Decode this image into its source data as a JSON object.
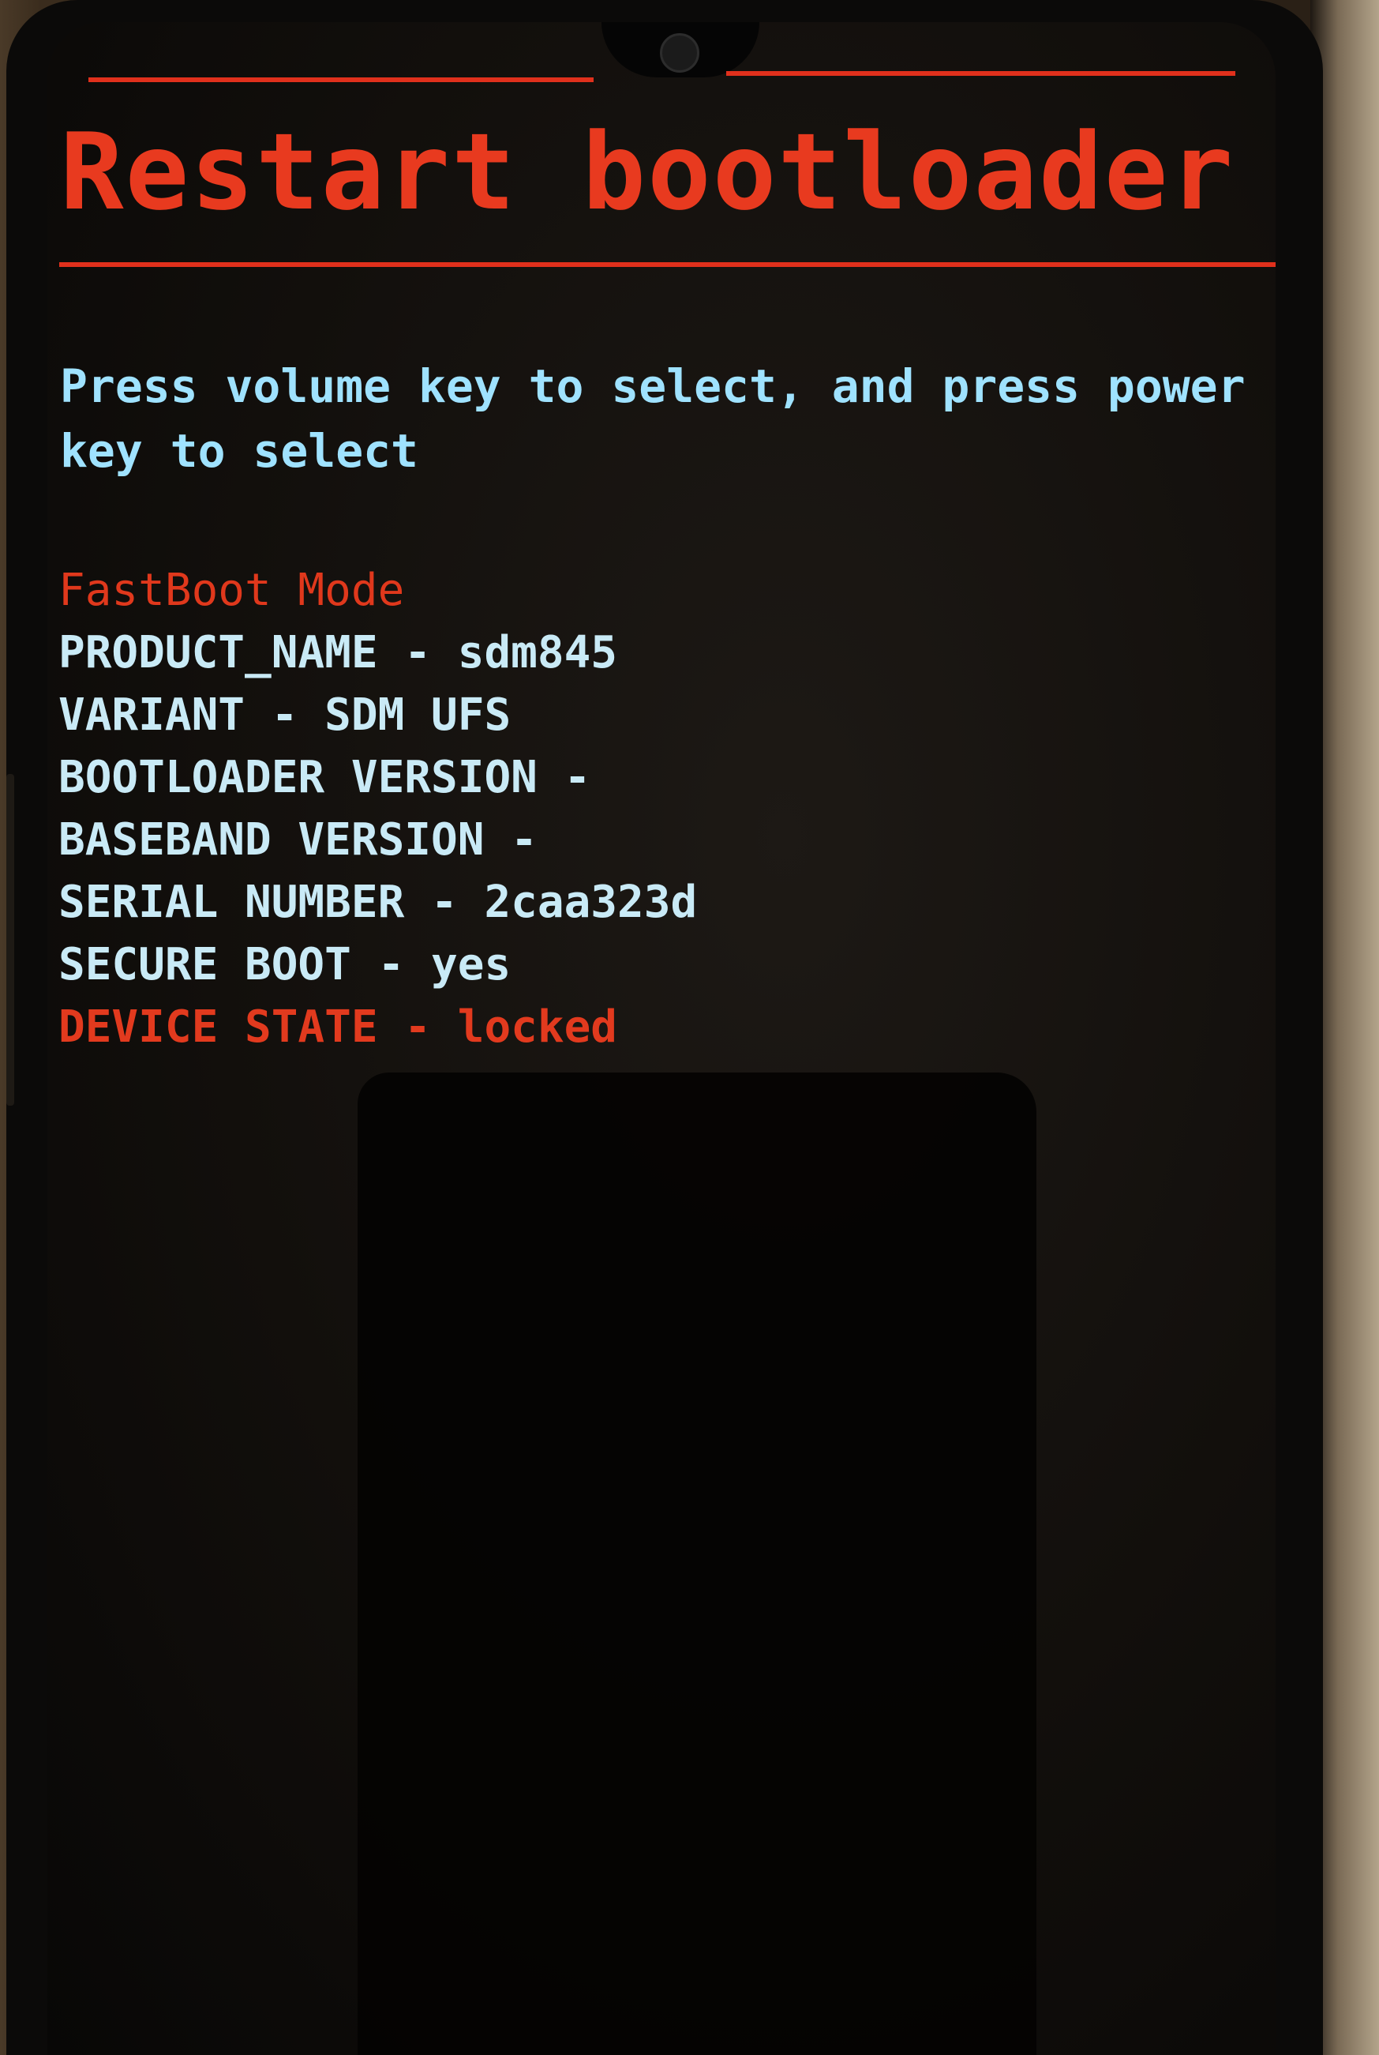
{
  "screen": {
    "title": "Restart bootloader",
    "instructions": "Press volume key to select, and press power\nkey to select"
  },
  "info": {
    "mode": "FastBoot Mode",
    "product_name": "PRODUCT_NAME - sdm845",
    "variant": "VARIANT - SDM UFS",
    "bootloader_version": "BOOTLOADER VERSION -",
    "baseband_version": "BASEBAND VERSION -",
    "serial_number": "SERIAL NUMBER - 2caa323d",
    "secure_boot": "SECURE BOOT - yes",
    "device_state": "DEVICE STATE - locked"
  },
  "colors": {
    "title": "#e83a1f",
    "text": "#c9eaf6",
    "instruction": "#9fe2ff",
    "warning": "#e23a1e",
    "background": "#120f0c"
  }
}
